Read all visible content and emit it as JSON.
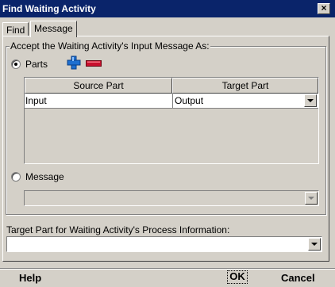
{
  "window": {
    "title": "Find Waiting Activity",
    "close_icon": "close-icon"
  },
  "tabs": [
    {
      "label": "Find"
    },
    {
      "label": "Message"
    }
  ],
  "input_message": {
    "group_label": "Accept the Waiting Activity's Input Message As:",
    "parts_option": {
      "label": "Parts",
      "selected": true
    },
    "message_option": {
      "label": "Message",
      "selected": false
    },
    "add_icon": "plus-icon",
    "remove_icon": "minus-icon",
    "table": {
      "columns": [
        "Source Part",
        "Target Part"
      ],
      "rows": [
        {
          "source": "Input",
          "target": "Output"
        }
      ]
    },
    "message_combo_value": ""
  },
  "process_info": {
    "label": "Target Part for Waiting Activity's Process Information:",
    "value": ""
  },
  "buttons": {
    "help": "Help",
    "ok": "OK",
    "cancel": "Cancel"
  },
  "colors": {
    "titlebar": "#0a246a",
    "face": "#d4d0c8",
    "plus": "#1e6fd0",
    "minus": "#c8102e"
  }
}
